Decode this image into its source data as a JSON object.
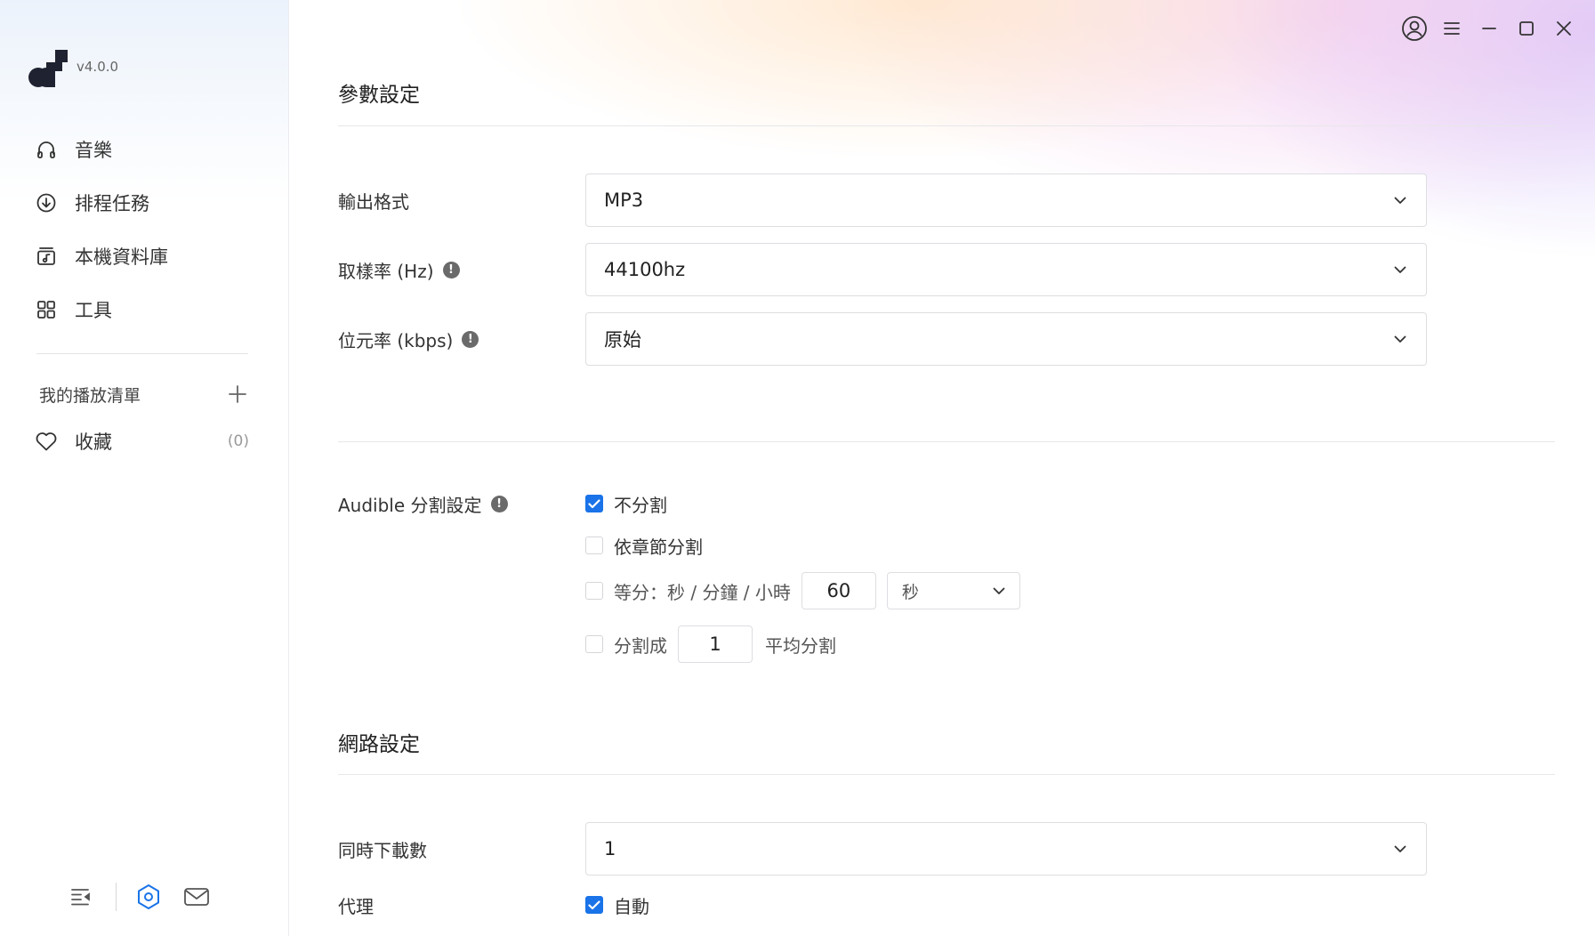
{
  "app": {
    "version": "v4.0.0"
  },
  "sidebar": {
    "nav": [
      {
        "label": "音樂",
        "icon": "headphones-icon"
      },
      {
        "label": "排程任務",
        "icon": "download-circle-icon"
      },
      {
        "label": "本機資料庫",
        "icon": "music-library-icon"
      },
      {
        "label": "工具",
        "icon": "grid-icon"
      }
    ],
    "playlists_title": "我的播放清單",
    "favorites": {
      "label": "收藏",
      "count": "(0)"
    },
    "bottom_icons": [
      "collapse-sidebar-icon",
      "settings-hex-icon",
      "mail-icon"
    ]
  },
  "window_controls": [
    "account-icon",
    "menu-icon",
    "minimize-icon",
    "maximize-icon",
    "close-icon"
  ],
  "params": {
    "title": "參數設定",
    "output_format": {
      "label": "輸出格式",
      "value": "MP3"
    },
    "sample_rate": {
      "label": "取樣率 (Hz)",
      "value": "44100hz"
    },
    "bitrate": {
      "label": "位元率 (kbps)",
      "value": "原始"
    }
  },
  "audible_split": {
    "label": "Audible 分割設定",
    "no_split": {
      "label": "不分割",
      "checked": true
    },
    "by_chapter": {
      "label": "依章節分割",
      "checked": false
    },
    "equal_time": {
      "label": "等分：秒 / 分鐘 / 小時",
      "checked": false,
      "value": "60",
      "unit": "秒"
    },
    "split_into": {
      "label_before": "分割成",
      "value": "1",
      "label_after": "平均分割",
      "checked": false
    }
  },
  "network": {
    "title": "網路設定",
    "concurrent_downloads": {
      "label": "同時下載數",
      "value": "1"
    },
    "proxy": {
      "label": "代理",
      "auto_label": "自動",
      "auto_checked": true
    }
  },
  "colors": {
    "accent": "#1a73e8",
    "info_icon": "#6a6a6a"
  }
}
